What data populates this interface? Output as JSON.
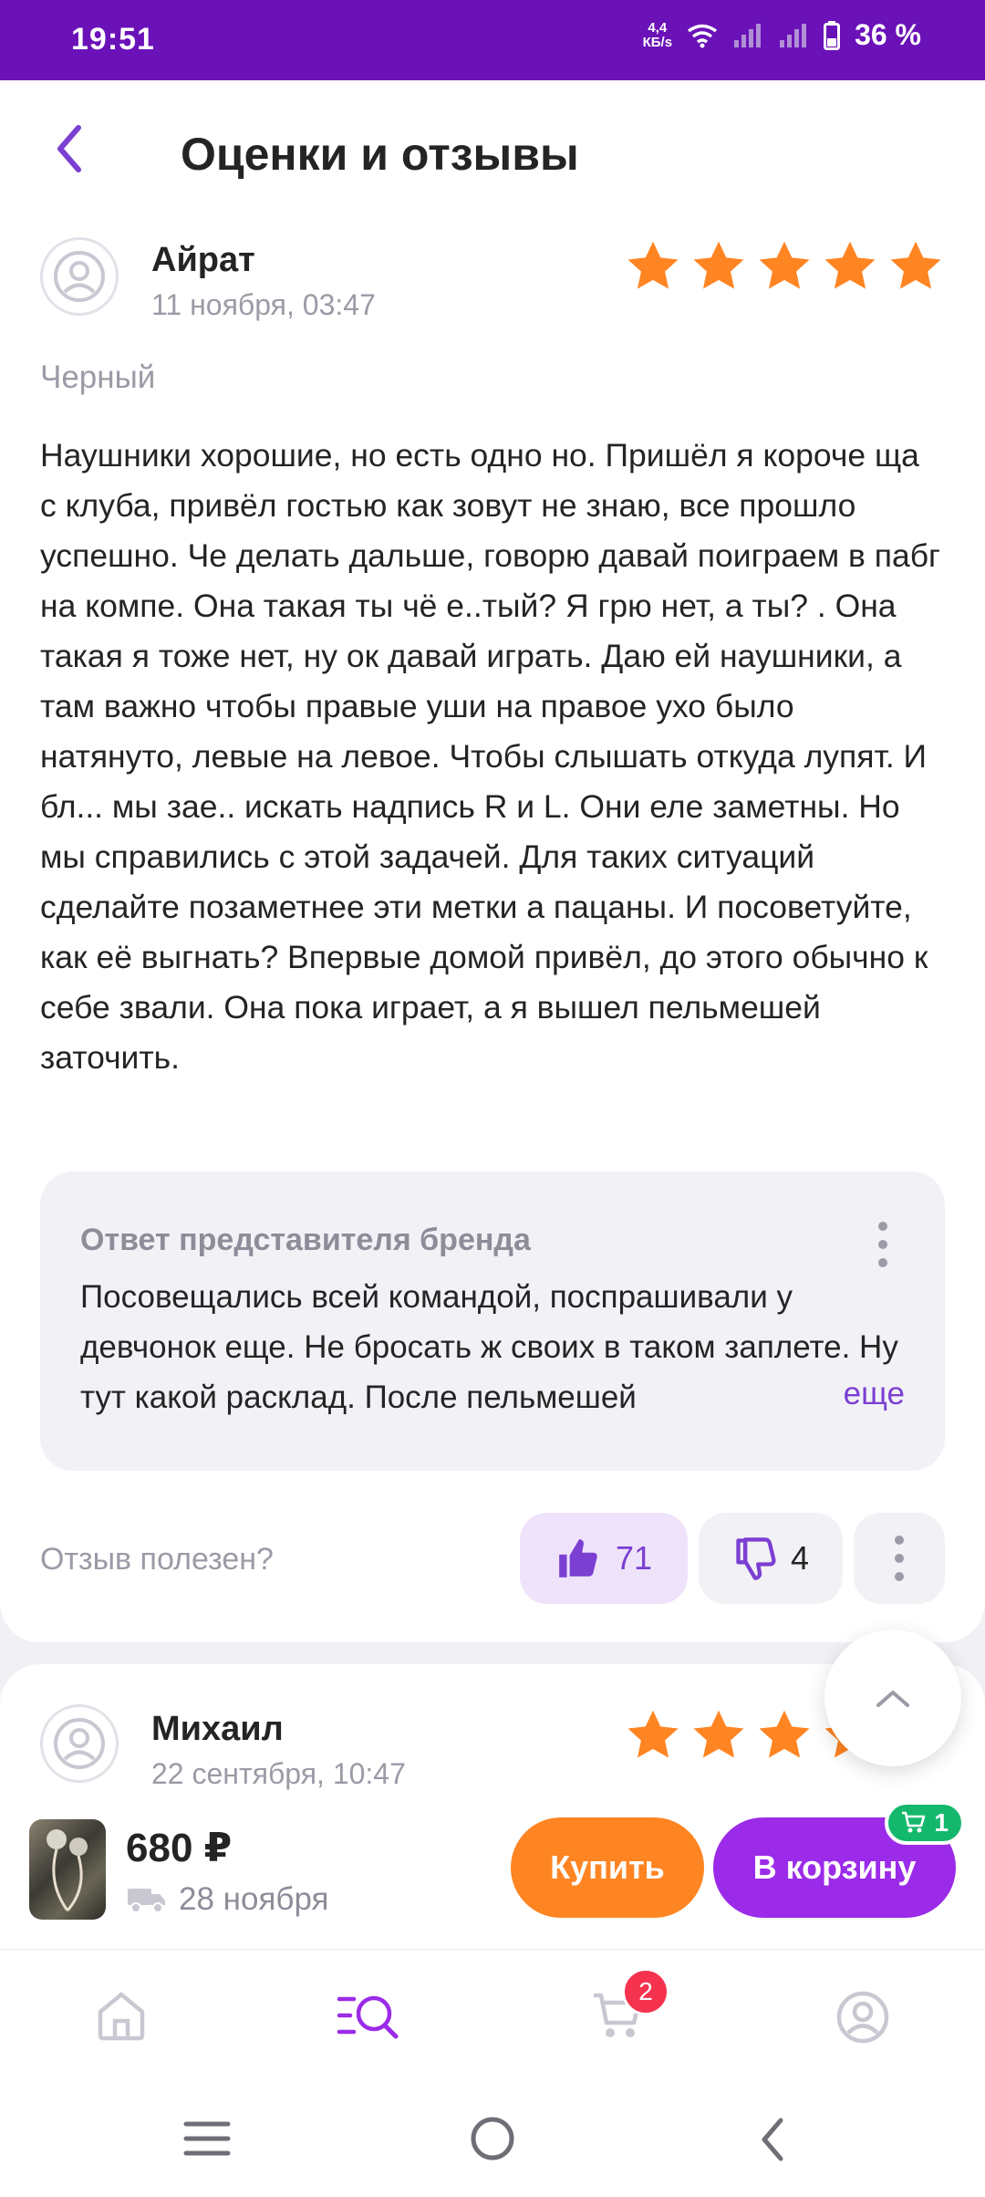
{
  "status_bar": {
    "time": "19:51",
    "net_speed_value": "4,4",
    "net_speed_unit": "КБ/s",
    "battery": "36 %"
  },
  "header": {
    "title": "Оценки и отзывы"
  },
  "reviews": [
    {
      "author": "Айрат",
      "date": "11 ноября, 03:47",
      "rating": 5,
      "variant": "Черный",
      "text": "Наушники хорошие, но есть одно но. Пришёл я короче ща с клуба, привёл гостью как зовут не знаю, все прошло успешно. Че делать дальше, говорю давай поиграем в пабг на компе. Она такая ты чё е..тый? Я грю нет, а ты? . Она такая я тоже нет, ну ок давай играть. Даю ей наушники, а там важно чтобы правые уши на правое ухо было натянуто, левые на левое. Чтобы слышать откуда лупят. И бл... мы зае.. искать надпись R и L. Они еле заметны. Но мы справились с этой задачей. Для таких ситуаций сделайте позаметнее эти метки а пацаны. И посоветуйте, как её выгнать? Впервые домой привёл, до этого обычно к себе звали. Она пока играет, а я  вышел пельмешей заточить.",
      "brand_reply": {
        "title": "Ответ представителя бренда",
        "text": "Посовещались всей командой, поспрашивали у девчонок еще. Не бросать ж своих в таком заплете. Ну тут какой расклад. После пельмешей",
        "more": "еще"
      },
      "useful_question": "Отзыв полезен?",
      "likes": "71",
      "dislikes": "4"
    },
    {
      "author": "Михаил",
      "date": "22 сентября, 10:47",
      "rating": 5
    }
  ],
  "buy_bar": {
    "price": "680 ₽",
    "delivery_date": "28 ноября",
    "buy_label": "Купить",
    "cart_label": "В корзину",
    "cart_count": "1"
  },
  "bottom_nav": {
    "cart_badge": "2"
  },
  "colors": {
    "brand": "#6a11b8",
    "buy": "#ff8422",
    "cart": "#9b2be8",
    "star": "#ff8422",
    "accent": "#7b3fd2"
  }
}
